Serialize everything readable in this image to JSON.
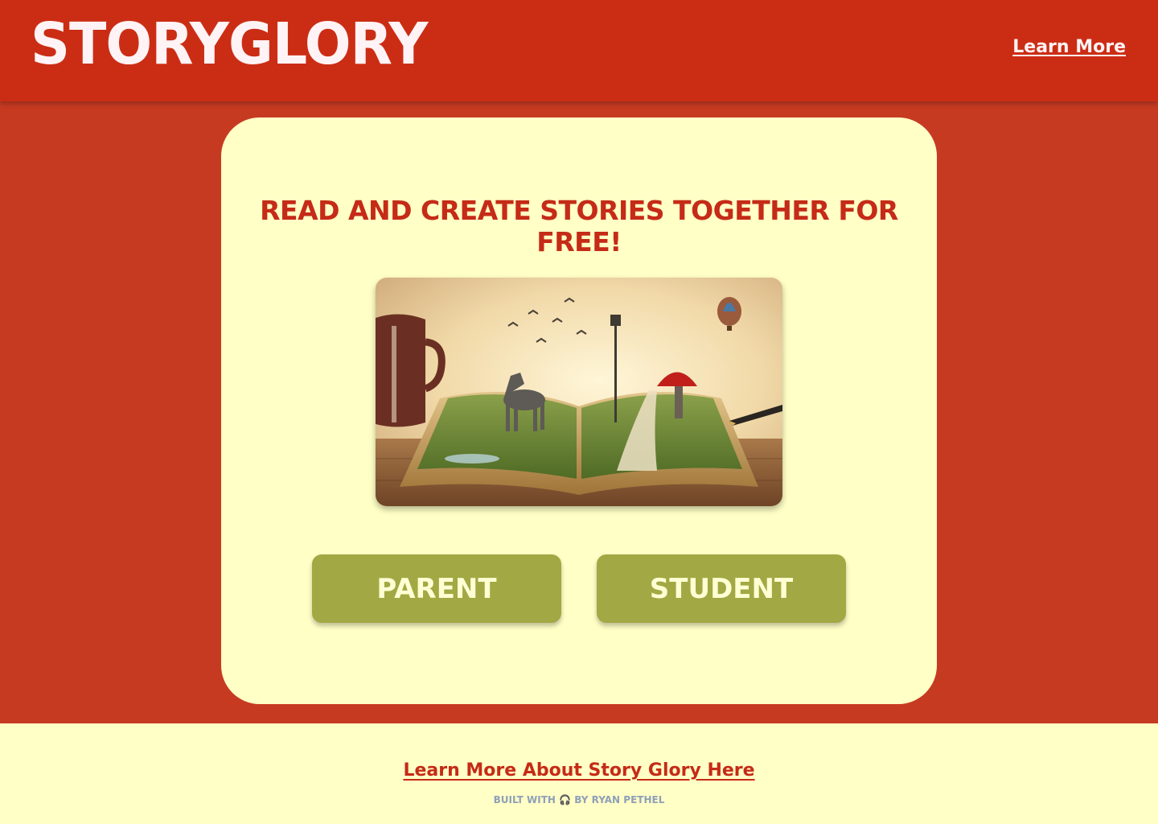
{
  "header": {
    "logo": "STORYGLORY",
    "learn_more": "Learn More"
  },
  "main": {
    "headline": "Read and create stories together for free!",
    "buttons": {
      "parent": "PARENT",
      "student": "STUDENT"
    }
  },
  "footer": {
    "learn_more_link": "Learn More About Story Glory Here",
    "built_with": "BUILT WITH",
    "by_author": "BY RYAN PETHEL",
    "icon": "headphones-icon"
  },
  "colors": {
    "header_bg": "#cb2d14",
    "page_bg": "#c73a22",
    "card_bg": "#ffffc6",
    "accent_text": "#c52b17",
    "button_bg": "#a2a843"
  }
}
